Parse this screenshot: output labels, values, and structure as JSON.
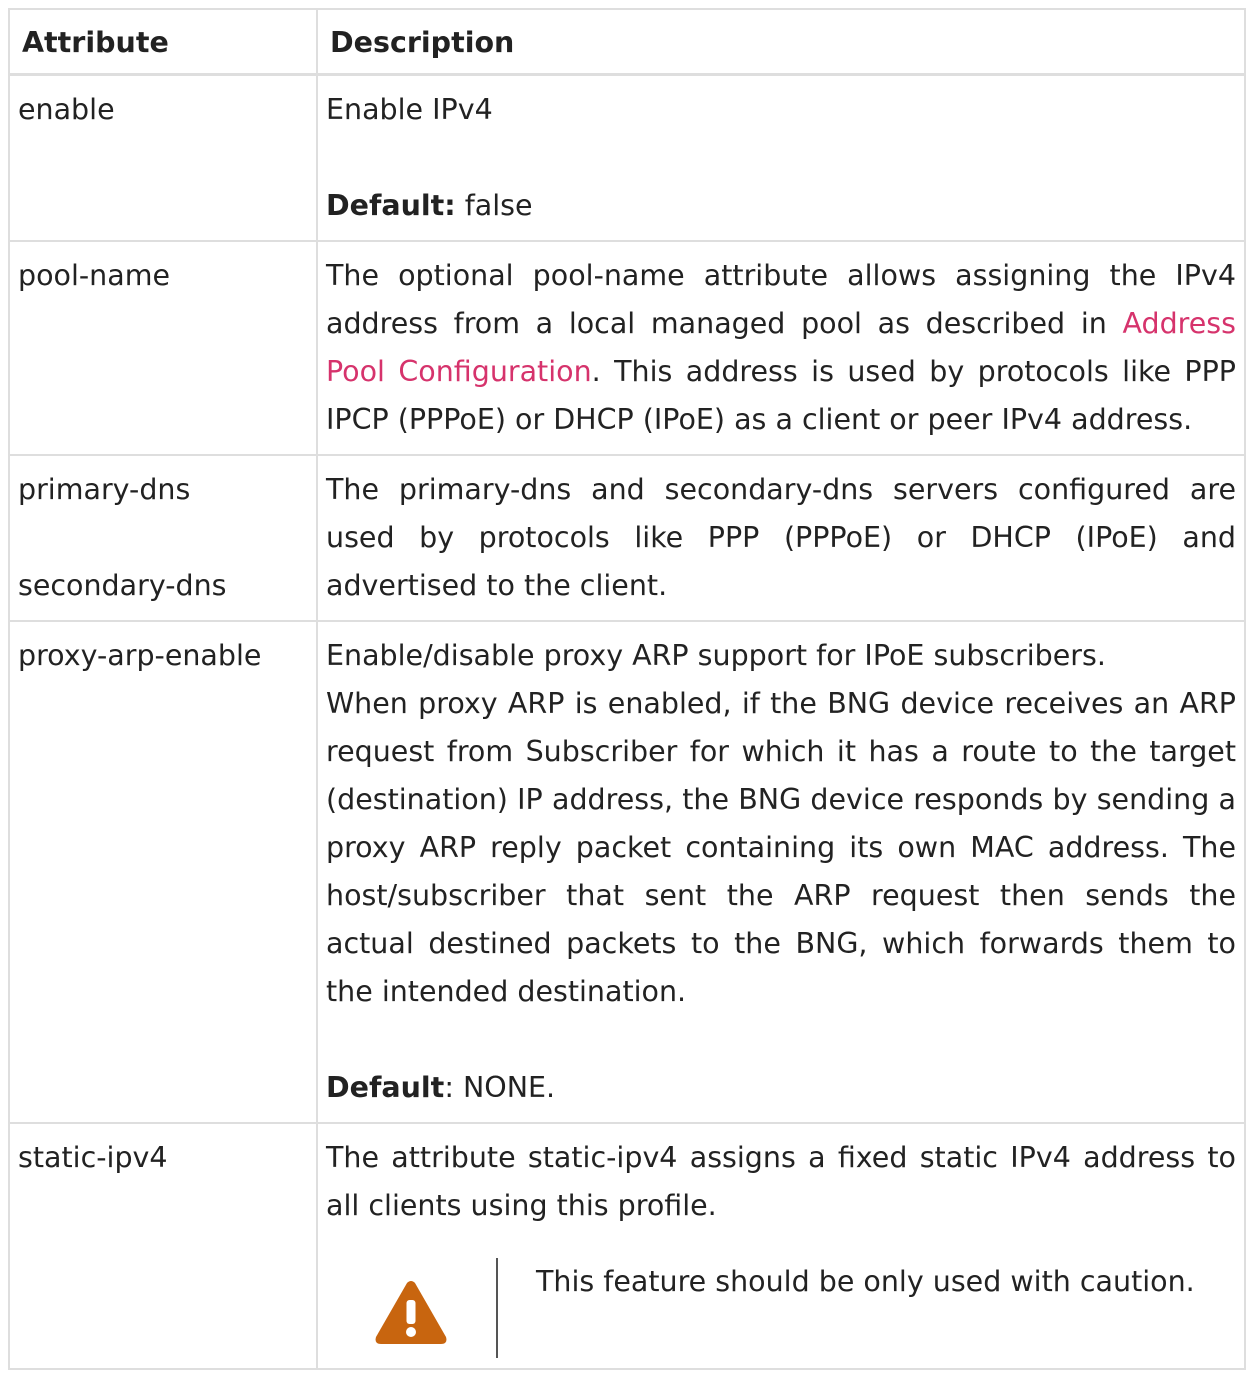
{
  "table": {
    "headers": [
      "Attribute",
      "Description"
    ],
    "rows": [
      {
        "attribute": [
          "enable"
        ],
        "description": {
          "text": "Enable IPv4",
          "default_label": "Default:",
          "default_value": " false"
        }
      },
      {
        "attribute": [
          "pool-name"
        ],
        "description": {
          "before_link": "The optional pool-name attribute allows assigning the IPv4 address from a local managed pool as described in ",
          "link": "Address Pool Configuration",
          "after_link": ". This address is used by protocols like PPP IPCP (PPPoE) or DHCP (IPoE) as a client or peer IPv4 address."
        }
      },
      {
        "attribute": [
          "primary-dns",
          "secondary-dns"
        ],
        "description": {
          "text": "The primary-dns and secondary-dns servers configured are used by protocols like PPP (PPPoE) or DHCP (IPoE) and advertised to the client."
        }
      },
      {
        "attribute": [
          "proxy-arp-enable"
        ],
        "description": {
          "line1": "Enable/disable proxy ARP support for IPoE subscribers.",
          "text": "When proxy ARP is enabled, if the BNG device receives an ARP request from Subscriber for which it has a route to the target (destination) IP address, the BNG device responds by sending a proxy ARP reply packet containing its own MAC address. The host/subscriber that sent the ARP request then sends the actual destined packets to the BNG, which forwards them to the intended destination.",
          "default_label": "Default",
          "default_value": ": NONE."
        }
      },
      {
        "attribute": [
          "static-ipv4"
        ],
        "description": {
          "text": "The attribute static-ipv4 assigns a fixed static IPv4 address to all clients using this profile.",
          "warning_icon": "warning-icon",
          "warning_text": "This feature should be only used with caution."
        }
      }
    ]
  },
  "colors": {
    "link": "#d6336c",
    "warning": "#c8650f",
    "border": "#dedede"
  }
}
